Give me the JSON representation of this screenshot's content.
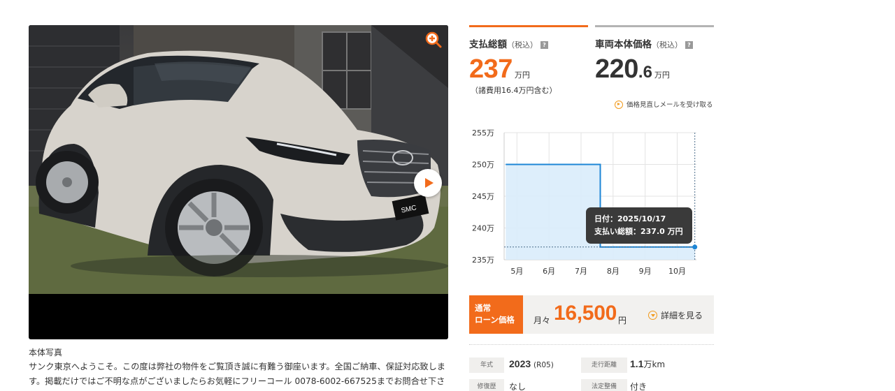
{
  "photo": {
    "caption": "本体写真",
    "description": "サンク東京へようこそ。この度は弊社の物件をご覧頂き誠に有難う御座います。全国ご納車、保証対応致します。掲載だけではご不明な点がございましたらお気軽にフリーコール 0078-6002-667525までお問合せ下さい。",
    "zoom_icon": "zoom-in-icon",
    "play_icon": "play-icon"
  },
  "total_price": {
    "title": "支払総額",
    "tax_note": "（税込）",
    "help": "?",
    "value": "237",
    "unit": "万円",
    "fees_note": "（諸費用16.4万円含む）"
  },
  "body_price": {
    "title": "車両本体価格",
    "tax_note": "（税込）",
    "help": "?",
    "value_int": "220",
    "value_dec": ".6",
    "unit": "万円"
  },
  "price_alert_link": "価格見直しメールを受け取る",
  "chart_data": {
    "type": "line",
    "step": true,
    "x": [
      "5月",
      "6月",
      "7月",
      "8月",
      "9月",
      "10月"
    ],
    "y_ticks": [
      "255万",
      "250万",
      "245万",
      "240万",
      "235万"
    ],
    "ylim": [
      235,
      255
    ],
    "series": [
      {
        "points": [
          {
            "x": 4.65,
            "y": 250
          },
          {
            "x": 7.6,
            "y": 250
          },
          {
            "x": 7.6,
            "y": 237
          },
          {
            "x": 10.55,
            "y": 237
          }
        ]
      }
    ],
    "xlim": [
      4.6,
      10.6
    ],
    "area_fill": true,
    "grid": true,
    "accent_color": "#1e86d6",
    "tooltip": {
      "date_label": "日付：2025/10/17",
      "amount_label": "支払い総額：237.0 万円"
    }
  },
  "loan": {
    "badge_line1": "通常",
    "badge_line2": "ローン価格",
    "monthly_label": "月々",
    "amount": "16,500",
    "yen": "円",
    "detail_link": "詳細を見る"
  },
  "specs": {
    "year_label": "年式",
    "year_value": "2023",
    "year_era": "(R05)",
    "mileage_label": "走行距離",
    "mileage_value": "1.1",
    "mileage_unit": "万km",
    "repair_label": "修復歴",
    "repair_value": "なし",
    "inspection_label": "法定整備",
    "inspection_value": "付き"
  },
  "colors": {
    "accent": "#f26b1b",
    "chart_line": "#1e86d6"
  }
}
